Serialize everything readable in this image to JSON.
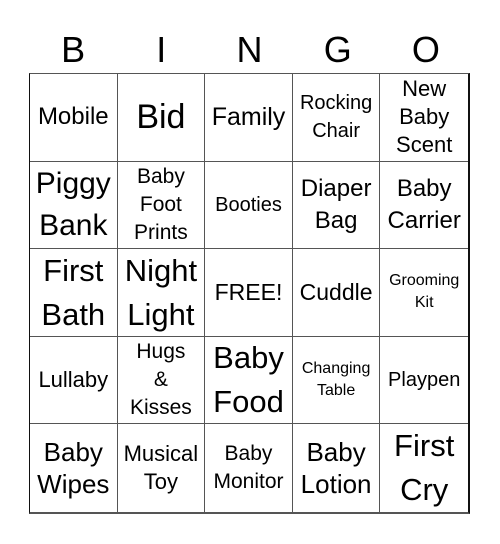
{
  "header": {
    "letters": [
      "B",
      "I",
      "N",
      "G",
      "O"
    ]
  },
  "cells": [
    "Mobile",
    "Bid",
    "Family",
    "Rocking\nChair",
    "New\nBaby\nScent",
    "Piggy\nBank",
    "Baby\nFoot\nPrints",
    "Booties",
    "Diaper\nBag",
    "Baby\nCarrier",
    "First\nBath",
    "Night\nLight",
    "FREE!",
    "Cuddle",
    "Grooming\nKit",
    "Lullaby",
    "Hugs\n&\nKisses",
    "Baby\nFood",
    "Changing\nTable",
    "Playpen",
    "Baby\nWipes",
    "Musical\nToy",
    "Baby\nMonitor",
    "Baby\nLotion",
    "First\nCry"
  ]
}
